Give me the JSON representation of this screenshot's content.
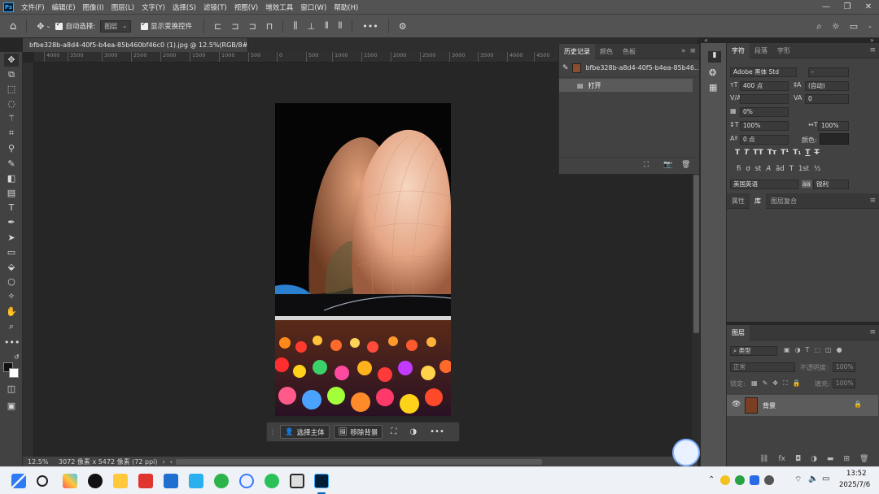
{
  "menu": {
    "app_icon": "Ps",
    "items": [
      "文件(F)",
      "编辑(E)",
      "图像(I)",
      "图层(L)",
      "文字(Y)",
      "选择(S)",
      "滤镜(T)",
      "视图(V)",
      "增效工具",
      "窗口(W)",
      "帮助(H)"
    ]
  },
  "options": {
    "auto_select_label": "自动选择:",
    "auto_select_value": "图层",
    "transform_label": "显示变换控件"
  },
  "document": {
    "tab_title": "bfbe328b-a8d4-40f5-b4ea-85b460bf46c0 (1).jpg @ 12.5%(RGB/8#)"
  },
  "ruler": {
    "ticks": [
      "4000",
      "3500",
      "3000",
      "2500",
      "2000",
      "1500",
      "1000",
      "500",
      "0",
      "500",
      "1000",
      "1500",
      "2000",
      "2500",
      "3000",
      "3500",
      "4000",
      "4500"
    ]
  },
  "status": {
    "zoom": "12.5%",
    "size": "3072 像素 x 5472 像素 (72 ppi)"
  },
  "context_bar": {
    "select_subject": "选择主体",
    "remove_bg": "移除背景"
  },
  "history_panel": {
    "tabs": [
      "历史记录",
      "颜色",
      "色板"
    ],
    "snapshot_name": "bfbe328b-a8d4-40f5-b4ea-85b46...",
    "steps": [
      "打开"
    ]
  },
  "char_panel": {
    "tabs": [
      "字符",
      "段落",
      "字形"
    ],
    "font_family": "Adobe 黑体 Std",
    "font_style": "-",
    "font_size": "400 点",
    "leading": "(自动)",
    "tracking": "0",
    "kerning": "",
    "scale_pct": "0%",
    "vscale": "100%",
    "hscale": "100%",
    "baseline": "0 点",
    "color_label": "颜色:",
    "type_buttons": [
      "T",
      "T",
      "TT",
      "Tт",
      "T¹",
      "T₁",
      "T",
      "T"
    ],
    "ot_buttons": [
      "fi",
      "ơ",
      "st",
      "A",
      "ād",
      "T",
      "1st",
      "½"
    ],
    "language": "美国英语",
    "aa_label": "aa",
    "aa_value": "锐利"
  },
  "mid_panel": {
    "tabs": [
      "属性",
      "库",
      "图层复合"
    ]
  },
  "layers_panel": {
    "title": "图层",
    "filter_placeholder": "类型",
    "blend_mode": "正常",
    "opacity_label": "不透明度:",
    "opacity_value": "100%",
    "lock_label": "锁定:",
    "fill_label": "填充:",
    "fill_value": "100%",
    "layer_name": "背景"
  },
  "taskbar": {
    "time": "13:52",
    "date": "2025/7/6"
  },
  "colors": {
    "ps_blue": "#31a8ff",
    "panel_bg": "#424242",
    "canvas_bg": "#262626"
  }
}
